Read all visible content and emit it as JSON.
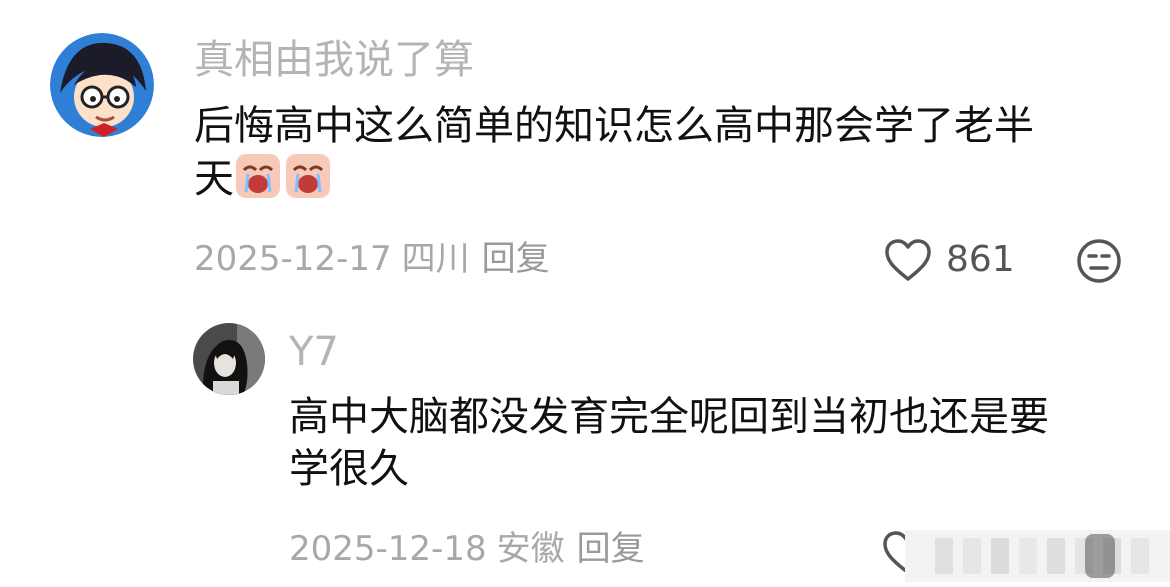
{
  "comment": {
    "username": "真相由我说了算",
    "text_line1": "后悔高中这么简单的知识怎么高中那会学了老半",
    "text_line2": "天",
    "emojis": [
      "crying-face-emoji",
      "crying-face-emoji"
    ],
    "date": "2025-12-17",
    "location": "四川",
    "reply_label": "回复",
    "likes": "861"
  },
  "reply": {
    "username": "Y7",
    "text_line1": "高中大脑都没发育完全呢回到当初也还是要",
    "text_line2": "学很久",
    "date": "2025-12-18",
    "location": "安徽",
    "reply_label": "回复"
  },
  "colors": {
    "username": "#b4b4b4",
    "text": "#111111",
    "meta": "#a8a8a8"
  },
  "icons": {
    "like": "heart-outline-icon",
    "dislike": "neutral-face-icon"
  }
}
